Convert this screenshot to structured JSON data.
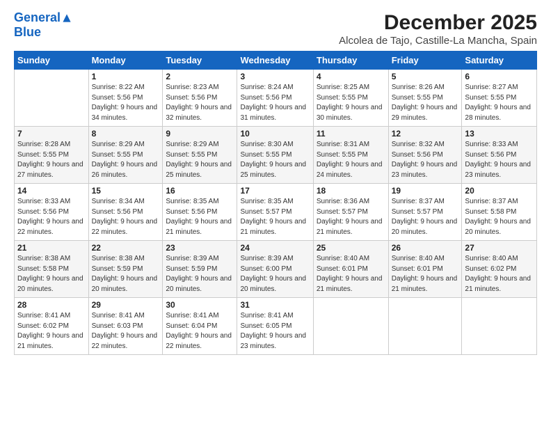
{
  "logo": {
    "line1": "General",
    "line2": "Blue"
  },
  "header": {
    "title": "December 2025",
    "subtitle": "Alcolea de Tajo, Castille-La Mancha, Spain"
  },
  "weekdays": [
    "Sunday",
    "Monday",
    "Tuesday",
    "Wednesday",
    "Thursday",
    "Friday",
    "Saturday"
  ],
  "weeks": [
    [
      {
        "num": "",
        "info": ""
      },
      {
        "num": "1",
        "info": "Sunrise: 8:22 AM\nSunset: 5:56 PM\nDaylight: 9 hours\nand 34 minutes."
      },
      {
        "num": "2",
        "info": "Sunrise: 8:23 AM\nSunset: 5:56 PM\nDaylight: 9 hours\nand 32 minutes."
      },
      {
        "num": "3",
        "info": "Sunrise: 8:24 AM\nSunset: 5:56 PM\nDaylight: 9 hours\nand 31 minutes."
      },
      {
        "num": "4",
        "info": "Sunrise: 8:25 AM\nSunset: 5:55 PM\nDaylight: 9 hours\nand 30 minutes."
      },
      {
        "num": "5",
        "info": "Sunrise: 8:26 AM\nSunset: 5:55 PM\nDaylight: 9 hours\nand 29 minutes."
      },
      {
        "num": "6",
        "info": "Sunrise: 8:27 AM\nSunset: 5:55 PM\nDaylight: 9 hours\nand 28 minutes."
      }
    ],
    [
      {
        "num": "7",
        "info": "Sunrise: 8:28 AM\nSunset: 5:55 PM\nDaylight: 9 hours\nand 27 minutes."
      },
      {
        "num": "8",
        "info": "Sunrise: 8:29 AM\nSunset: 5:55 PM\nDaylight: 9 hours\nand 26 minutes."
      },
      {
        "num": "9",
        "info": "Sunrise: 8:29 AM\nSunset: 5:55 PM\nDaylight: 9 hours\nand 25 minutes."
      },
      {
        "num": "10",
        "info": "Sunrise: 8:30 AM\nSunset: 5:55 PM\nDaylight: 9 hours\nand 25 minutes."
      },
      {
        "num": "11",
        "info": "Sunrise: 8:31 AM\nSunset: 5:55 PM\nDaylight: 9 hours\nand 24 minutes."
      },
      {
        "num": "12",
        "info": "Sunrise: 8:32 AM\nSunset: 5:56 PM\nDaylight: 9 hours\nand 23 minutes."
      },
      {
        "num": "13",
        "info": "Sunrise: 8:33 AM\nSunset: 5:56 PM\nDaylight: 9 hours\nand 23 minutes."
      }
    ],
    [
      {
        "num": "14",
        "info": "Sunrise: 8:33 AM\nSunset: 5:56 PM\nDaylight: 9 hours\nand 22 minutes."
      },
      {
        "num": "15",
        "info": "Sunrise: 8:34 AM\nSunset: 5:56 PM\nDaylight: 9 hours\nand 22 minutes."
      },
      {
        "num": "16",
        "info": "Sunrise: 8:35 AM\nSunset: 5:56 PM\nDaylight: 9 hours\nand 21 minutes."
      },
      {
        "num": "17",
        "info": "Sunrise: 8:35 AM\nSunset: 5:57 PM\nDaylight: 9 hours\nand 21 minutes."
      },
      {
        "num": "18",
        "info": "Sunrise: 8:36 AM\nSunset: 5:57 PM\nDaylight: 9 hours\nand 21 minutes."
      },
      {
        "num": "19",
        "info": "Sunrise: 8:37 AM\nSunset: 5:57 PM\nDaylight: 9 hours\nand 20 minutes."
      },
      {
        "num": "20",
        "info": "Sunrise: 8:37 AM\nSunset: 5:58 PM\nDaylight: 9 hours\nand 20 minutes."
      }
    ],
    [
      {
        "num": "21",
        "info": "Sunrise: 8:38 AM\nSunset: 5:58 PM\nDaylight: 9 hours\nand 20 minutes."
      },
      {
        "num": "22",
        "info": "Sunrise: 8:38 AM\nSunset: 5:59 PM\nDaylight: 9 hours\nand 20 minutes."
      },
      {
        "num": "23",
        "info": "Sunrise: 8:39 AM\nSunset: 5:59 PM\nDaylight: 9 hours\nand 20 minutes."
      },
      {
        "num": "24",
        "info": "Sunrise: 8:39 AM\nSunset: 6:00 PM\nDaylight: 9 hours\nand 20 minutes."
      },
      {
        "num": "25",
        "info": "Sunrise: 8:40 AM\nSunset: 6:01 PM\nDaylight: 9 hours\nand 21 minutes."
      },
      {
        "num": "26",
        "info": "Sunrise: 8:40 AM\nSunset: 6:01 PM\nDaylight: 9 hours\nand 21 minutes."
      },
      {
        "num": "27",
        "info": "Sunrise: 8:40 AM\nSunset: 6:02 PM\nDaylight: 9 hours\nand 21 minutes."
      }
    ],
    [
      {
        "num": "28",
        "info": "Sunrise: 8:41 AM\nSunset: 6:02 PM\nDaylight: 9 hours\nand 21 minutes."
      },
      {
        "num": "29",
        "info": "Sunrise: 8:41 AM\nSunset: 6:03 PM\nDaylight: 9 hours\nand 22 minutes."
      },
      {
        "num": "30",
        "info": "Sunrise: 8:41 AM\nSunset: 6:04 PM\nDaylight: 9 hours\nand 22 minutes."
      },
      {
        "num": "31",
        "info": "Sunrise: 8:41 AM\nSunset: 6:05 PM\nDaylight: 9 hours\nand 23 minutes."
      },
      {
        "num": "",
        "info": ""
      },
      {
        "num": "",
        "info": ""
      },
      {
        "num": "",
        "info": ""
      }
    ]
  ]
}
